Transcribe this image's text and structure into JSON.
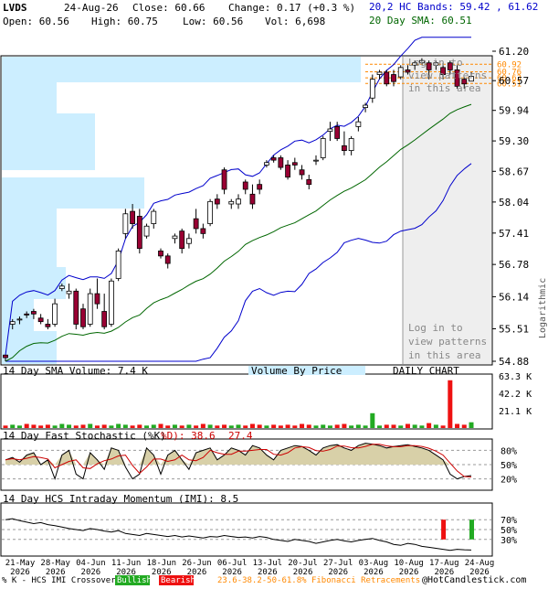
{
  "header": {
    "symbol": "LVDS",
    "date": "24-Aug-26",
    "close_label": "Close: 60.66",
    "change_label": "Change: 0.17 (+0.3 %)",
    "open_label": "Open: 60.56",
    "high_label": "High: 60.75",
    "low_label": "Low: 60.56",
    "vol_label": "Vol: 6,698",
    "bands_label": "20,2 HC Bands: 59.42 , 61.62",
    "sma_label": "20 Day SMA: 60.51"
  },
  "colors": {
    "bull": "#ffffff",
    "bear": "#990033",
    "green_vol": "#22aa22",
    "red_vol": "#ee1111",
    "band": "#0000cc",
    "sma": "#006600",
    "vbp": "#cceeff",
    "fib": "#ff8800",
    "grid": "#cccccc"
  },
  "main": {
    "y_ticks": [
      "61.20",
      "60.57",
      "59.94",
      "59.30",
      "58.67",
      "58.04",
      "57.41",
      "56.78",
      "56.14",
      "55.51",
      "54.88"
    ],
    "y_side_label": "Logarithmic",
    "fib_labels": [
      "60.92",
      "60.76",
      "60.63",
      "60.51"
    ],
    "login_text_top": [
      "Log in to",
      "view patterns",
      "in this area"
    ],
    "login_text_bottom": [
      "Log in to",
      "view patterns",
      "in this area"
    ]
  },
  "volume_panel": {
    "title": "14 Day SMA Volume: 7.4 K",
    "vbp_label": "Volume By Price",
    "daily_label": "DAILY CHART",
    "y_ticks": [
      "63.3 K",
      "42.2 K",
      "21.1 K"
    ]
  },
  "stoch_panel": {
    "title": "14 Day Fast Stochastic (%K)",
    "d_label": "%D): 38.6",
    "k_value": "27.4",
    "y_ticks": [
      "80%",
      "50%",
      "20%"
    ]
  },
  "mom_panel": {
    "title": "14 Day HCS Intraday Momentum (IMI): 8.5",
    "y_ticks": [
      "70%",
      "50%",
      "30%"
    ]
  },
  "x_axis": {
    "ticks": [
      {
        "d": "21-May",
        "y": "2026"
      },
      {
        "d": "28-May",
        "y": "2026"
      },
      {
        "d": "04-Jun",
        "y": "2026"
      },
      {
        "d": "11-Jun",
        "y": "2026"
      },
      {
        "d": "18-Jun",
        "y": "2026"
      },
      {
        "d": "26-Jun",
        "y": "2026"
      },
      {
        "d": "06-Jul",
        "y": "2026"
      },
      {
        "d": "13-Jul",
        "y": "2026"
      },
      {
        "d": "20-Jul",
        "y": "2026"
      },
      {
        "d": "27-Jul",
        "y": "2026"
      },
      {
        "d": "03-Aug",
        "y": "2026"
      },
      {
        "d": "10-Aug",
        "y": "2026"
      },
      {
        "d": "17-Aug",
        "y": "2026"
      },
      {
        "d": "24-Aug",
        "y": "2026"
      }
    ]
  },
  "footer": {
    "legend_prefix": "% K - HCS IMI Crossover,",
    "bullish": "Bullish",
    "bearish": "Bearish",
    "fib_text": "23.6-38.2-50-61.8% Fibonacci Retracements",
    "copyright": "@HotCandlestick.com"
  },
  "chart_data": {
    "type": "candlestick",
    "title": "LVDS",
    "scale": "logarithmic",
    "ylim": [
      54.88,
      61.2
    ],
    "series": [
      {
        "name": "20 Day SMA",
        "last": 60.51
      },
      {
        "name": "20,2 HC Bands",
        "upper_last": 61.62,
        "lower_last": 59.42
      }
    ],
    "last_candle": {
      "date": "24-Aug-26",
      "open": 60.56,
      "high": 60.75,
      "low": 60.56,
      "close": 60.66,
      "volume": 6698
    },
    "candles": [
      [
        55.0,
        55.0,
        54.88,
        54.95
      ],
      [
        55.6,
        55.7,
        55.5,
        55.65
      ],
      [
        55.7,
        55.75,
        55.6,
        55.7
      ],
      [
        55.8,
        55.85,
        55.72,
        55.78
      ],
      [
        55.85,
        55.9,
        55.7,
        55.8
      ],
      [
        55.72,
        55.8,
        55.6,
        55.65
      ],
      [
        55.6,
        55.7,
        55.5,
        55.55
      ],
      [
        55.6,
        56.1,
        55.55,
        56.0
      ],
      [
        56.3,
        56.4,
        56.25,
        56.35
      ],
      [
        56.2,
        56.4,
        56.1,
        56.25
      ],
      [
        56.25,
        56.3,
        55.5,
        55.6
      ],
      [
        55.9,
        56.0,
        55.5,
        55.55
      ],
      [
        55.6,
        56.3,
        55.55,
        56.2
      ],
      [
        56.2,
        56.5,
        55.9,
        56.0
      ],
      [
        55.85,
        56.2,
        55.5,
        55.55
      ],
      [
        55.6,
        56.5,
        55.55,
        56.45
      ],
      [
        56.5,
        57.1,
        56.45,
        57.05
      ],
      [
        57.4,
        57.9,
        57.3,
        57.8
      ],
      [
        57.85,
        58.0,
        57.5,
        57.6
      ],
      [
        57.75,
        57.9,
        57.0,
        57.1
      ],
      [
        57.35,
        57.6,
        57.3,
        57.55
      ],
      [
        57.6,
        57.9,
        57.5,
        57.85
      ],
      [
        57.05,
        57.1,
        56.9,
        56.95
      ],
      [
        56.95,
        57.0,
        56.7,
        56.8
      ],
      [
        57.3,
        57.4,
        57.2,
        57.35
      ],
      [
        57.45,
        57.5,
        57.0,
        57.1
      ],
      [
        57.2,
        57.4,
        57.1,
        57.3
      ],
      [
        57.7,
        57.9,
        57.4,
        57.5
      ],
      [
        57.5,
        57.6,
        57.3,
        57.4
      ],
      [
        57.6,
        58.1,
        57.55,
        58.05
      ],
      [
        58.1,
        58.2,
        57.9,
        58.0
      ],
      [
        58.7,
        58.75,
        58.2,
        58.3
      ],
      [
        58.0,
        58.1,
        57.9,
        58.05
      ],
      [
        58.0,
        58.2,
        57.9,
        58.1
      ],
      [
        58.45,
        58.5,
        58.2,
        58.3
      ],
      [
        58.2,
        58.4,
        57.9,
        58.0
      ],
      [
        58.4,
        58.5,
        58.2,
        58.3
      ],
      [
        58.8,
        58.9,
        58.75,
        58.85
      ],
      [
        58.95,
        59.0,
        58.85,
        58.9
      ],
      [
        58.95,
        59.0,
        58.7,
        58.75
      ],
      [
        58.8,
        58.9,
        58.5,
        58.55
      ],
      [
        58.85,
        58.95,
        58.7,
        58.8
      ],
      [
        58.7,
        58.8,
        58.5,
        58.6
      ],
      [
        58.5,
        58.6,
        58.3,
        58.4
      ],
      [
        58.9,
        59.0,
        58.8,
        58.9
      ],
      [
        58.95,
        59.4,
        58.9,
        59.35
      ],
      [
        59.5,
        59.7,
        59.3,
        59.55
      ],
      [
        59.6,
        59.7,
        59.3,
        59.35
      ],
      [
        59.2,
        59.5,
        59.0,
        59.1
      ],
      [
        59.1,
        59.4,
        59.0,
        59.35
      ],
      [
        59.6,
        59.8,
        59.5,
        59.7
      ],
      [
        60.0,
        60.1,
        59.9,
        60.05
      ],
      [
        60.2,
        60.7,
        60.1,
        60.6
      ],
      [
        60.7,
        60.8,
        60.6,
        60.75
      ],
      [
        60.75,
        60.8,
        60.45,
        60.5
      ],
      [
        60.7,
        60.8,
        60.45,
        60.55
      ],
      [
        60.65,
        60.9,
        60.6,
        60.85
      ],
      [
        60.8,
        60.9,
        60.7,
        60.75
      ],
      [
        60.9,
        61.0,
        60.8,
        60.95
      ],
      [
        60.95,
        61.05,
        60.9,
        61.0
      ],
      [
        60.95,
        61.0,
        60.6,
        60.8
      ],
      [
        60.9,
        61.0,
        60.8,
        60.95
      ],
      [
        60.85,
        60.95,
        60.6,
        60.7
      ],
      [
        60.95,
        61.0,
        60.7,
        60.8
      ],
      [
        60.8,
        60.9,
        60.4,
        60.45
      ],
      [
        60.6,
        60.65,
        60.4,
        60.5
      ],
      [
        60.56,
        60.75,
        60.56,
        60.66
      ]
    ]
  }
}
